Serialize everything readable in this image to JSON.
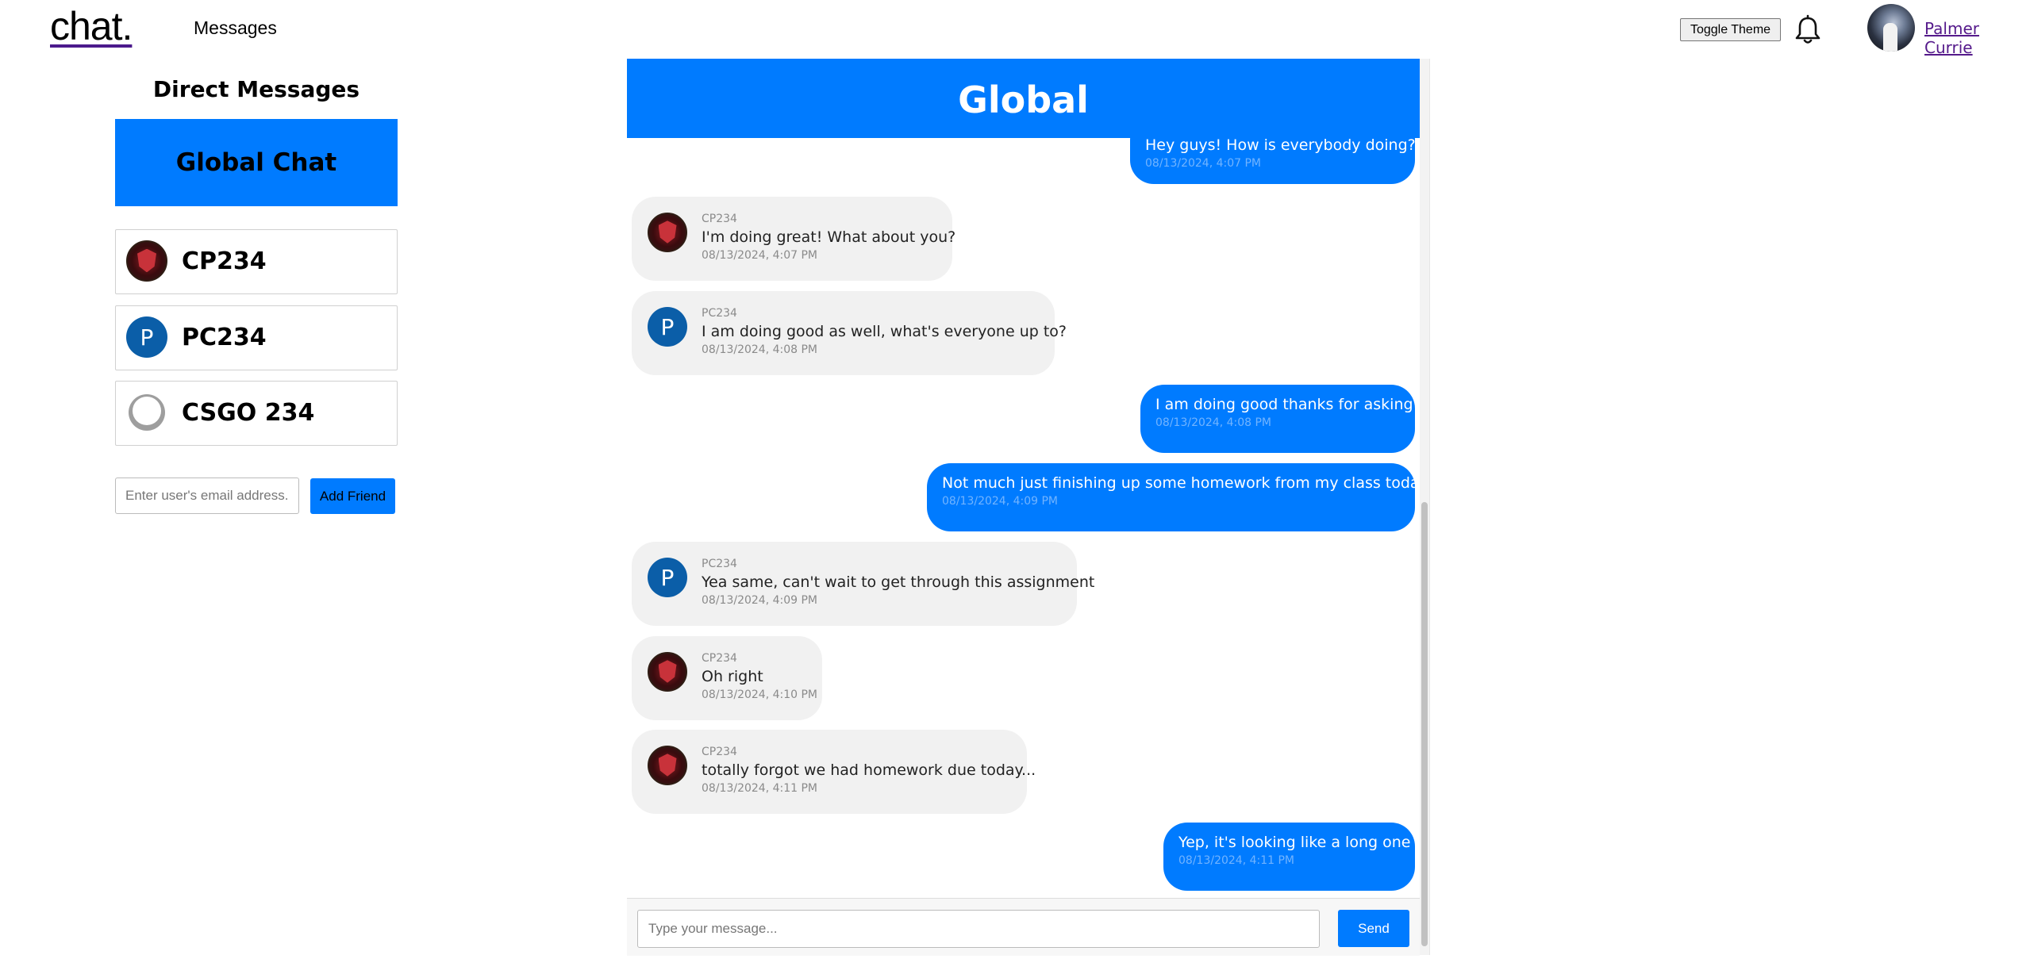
{
  "app": {
    "logo": "chat.",
    "nav_messages": "Messages"
  },
  "topbar": {
    "toggle_theme_label": "Toggle Theme",
    "notification_icon": "bell-icon",
    "user_name": "Palmer Currie"
  },
  "sidebar": {
    "title": "Direct Messages",
    "global_chat_label": "Global Chat",
    "contacts": [
      {
        "name": "CP234",
        "avatar": "shield-avatar"
      },
      {
        "name": "PC234",
        "avatar": "letter-avatar",
        "initial": "P"
      },
      {
        "name": "CSGO 234",
        "avatar": "default-avatar"
      }
    ],
    "email_placeholder": "Enter user's email address.",
    "add_friend_label": "Add Friend"
  },
  "chat": {
    "title": "Global",
    "messages": [
      {
        "mine": true,
        "text": "Hey guys! How is everybody doing?",
        "time": "08/13/2024, 4:07 PM"
      },
      {
        "mine": false,
        "sender": "CP234",
        "avatar": "shield-avatar",
        "text": "I'm doing great! What about you?",
        "time": "08/13/2024, 4:07 PM"
      },
      {
        "mine": false,
        "sender": "PC234",
        "avatar": "letter-avatar",
        "initial": "P",
        "text": "I am doing good as well, what's everyone up to?",
        "time": "08/13/2024, 4:08 PM"
      },
      {
        "mine": true,
        "text": "I am doing good thanks for asking",
        "time": "08/13/2024, 4:08 PM"
      },
      {
        "mine": true,
        "text": "Not much just finishing up some homework from my class today",
        "time": "08/13/2024, 4:09 PM"
      },
      {
        "mine": false,
        "sender": "PC234",
        "avatar": "letter-avatar",
        "initial": "P",
        "text": "Yea same, can't wait to get through this assignment",
        "time": "08/13/2024, 4:09 PM"
      },
      {
        "mine": false,
        "sender": "CP234",
        "avatar": "shield-avatar",
        "text": "Oh right",
        "time": "08/13/2024, 4:10 PM"
      },
      {
        "mine": false,
        "sender": "CP234",
        "avatar": "shield-avatar",
        "text": "totally forgot we had homework due today...",
        "time": "08/13/2024, 4:11 PM"
      },
      {
        "mine": true,
        "text": "Yep, it's looking like a long one",
        "time": "08/13/2024, 4:11 PM"
      }
    ],
    "compose_placeholder": "Type your message...",
    "send_label": "Send"
  },
  "colors": {
    "accent": "#007bff",
    "bubble_other": "#f1f1f1",
    "link": "#551a8b"
  }
}
